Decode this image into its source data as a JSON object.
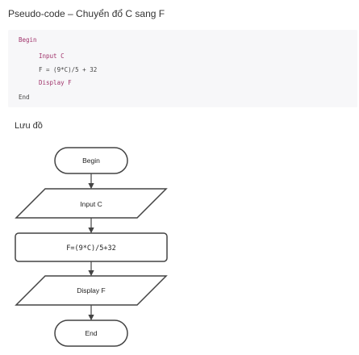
{
  "header": {
    "title": "Pseudo-code – Chuyển đổ C sang F"
  },
  "pseudocode": {
    "lines": [
      {
        "text": "Begin",
        "indent": 0,
        "keyword": true
      },
      {
        "text": "Input C",
        "indent": 1,
        "keyword": true
      },
      {
        "text": "F = (9*C)/5 + 32",
        "indent": 1,
        "keyword": false
      },
      {
        "text": "Display F",
        "indent": 1,
        "keyword": true
      },
      {
        "text": "End",
        "indent": 0,
        "keyword": false
      }
    ]
  },
  "flowchart": {
    "label": "Lưu đồ",
    "nodes": {
      "begin": "Begin",
      "input": "Input C",
      "process": "F=(9*C)/5+32",
      "output": "Display F",
      "end": "End"
    }
  },
  "colors": {
    "keyword": "#a0336b",
    "code_bg": "#f7f7f9",
    "stroke": "#444444"
  }
}
